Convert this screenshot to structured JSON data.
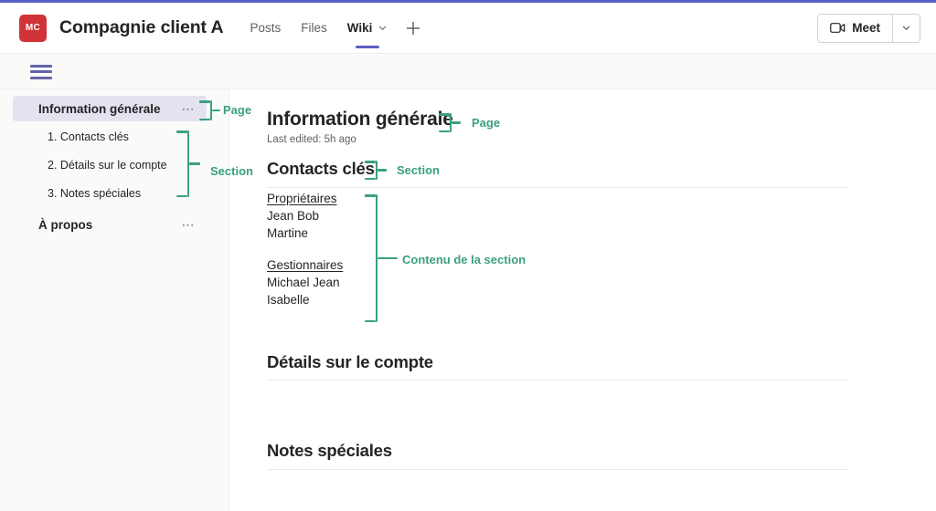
{
  "header": {
    "avatar_initials": "MC",
    "team_title": "Compagnie client A",
    "tabs": [
      {
        "label": "Posts",
        "active": false
      },
      {
        "label": "Files",
        "active": false
      },
      {
        "label": "Wiki",
        "active": true
      }
    ],
    "add_tab_icon": "plus-icon",
    "meet_label": "Meet",
    "meet_icon": "video-camera-icon",
    "meet_caret_icon": "chevron-down-icon"
  },
  "wiki_toolbar": {
    "menu_icon": "hamburger-menu-icon"
  },
  "sidebar": {
    "page": {
      "label": "Information générale",
      "selected": true,
      "overflow_icon": "ellipsis-icon"
    },
    "sections": [
      {
        "label": "1. Contacts clés"
      },
      {
        "label": "2. Détails sur le compte"
      },
      {
        "label": "3. Notes spéciales"
      }
    ],
    "page2": {
      "label": "À propos",
      "overflow_icon": "ellipsis-icon"
    }
  },
  "main": {
    "page_title": "Information générale",
    "last_edited": "Last edited: 5h ago",
    "sections": [
      {
        "heading": "Contacts clés"
      },
      {
        "heading": "Détails sur le compte"
      },
      {
        "heading": "Notes spéciales"
      }
    ],
    "contacts": {
      "group1_title": "Propriétaires",
      "group1_items": [
        "Jean Bob",
        "Martine"
      ],
      "group2_title": "Gestionnaires",
      "group2_items": [
        "Michael Jean",
        "Isabelle"
      ]
    }
  },
  "annotations": {
    "color": "#3aa081",
    "sidebar_page": "Page",
    "sidebar_section": "Section",
    "main_page": "Page",
    "main_section": "Section",
    "main_content": "Contenu de la section"
  },
  "colors": {
    "brand_purple": "#5b5fc7",
    "avatar_red": "#d13438",
    "selected_lavender": "#e5e2f0",
    "annotation_green": "#3aa081"
  }
}
